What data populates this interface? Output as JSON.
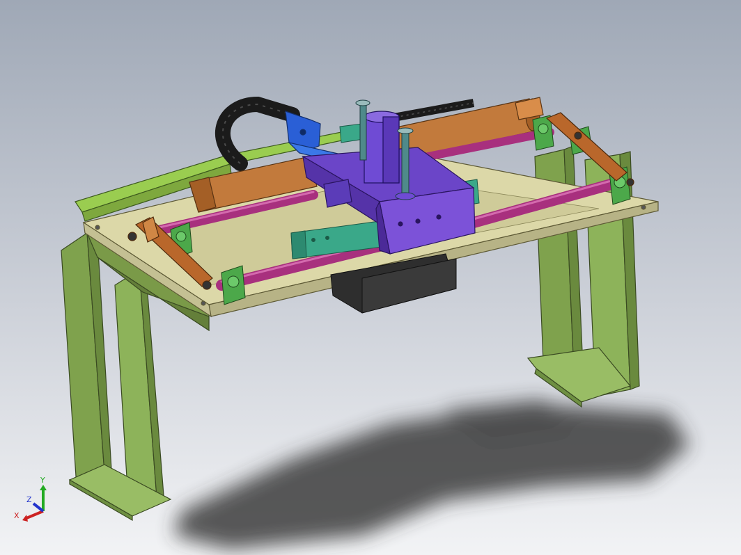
{
  "triad": {
    "x_label": "X",
    "y_label": "Y",
    "z_label": "Z",
    "x_color": "#cc2222",
    "y_color": "#22aa22",
    "z_color": "#2233cc"
  },
  "colors": {
    "background_top": "#9fa8b6",
    "background_bottom": "#f2f3f5",
    "frame_green": "#8fb35a",
    "plate_beige": "#dcd8a8",
    "rail_green": "#8fbf4f",
    "rod_magenta": "#a8307e",
    "cylinder_orange": "#c27a3c",
    "arm_orange": "#b9672b",
    "carriage_purple": "#6b45c8",
    "block_teal": "#3aa889",
    "motor_dark": "#2e2e2e",
    "chain_black": "#1b1b1b",
    "bracket_blue": "#2a5fd6",
    "bearing_green": "#4ca84a"
  }
}
